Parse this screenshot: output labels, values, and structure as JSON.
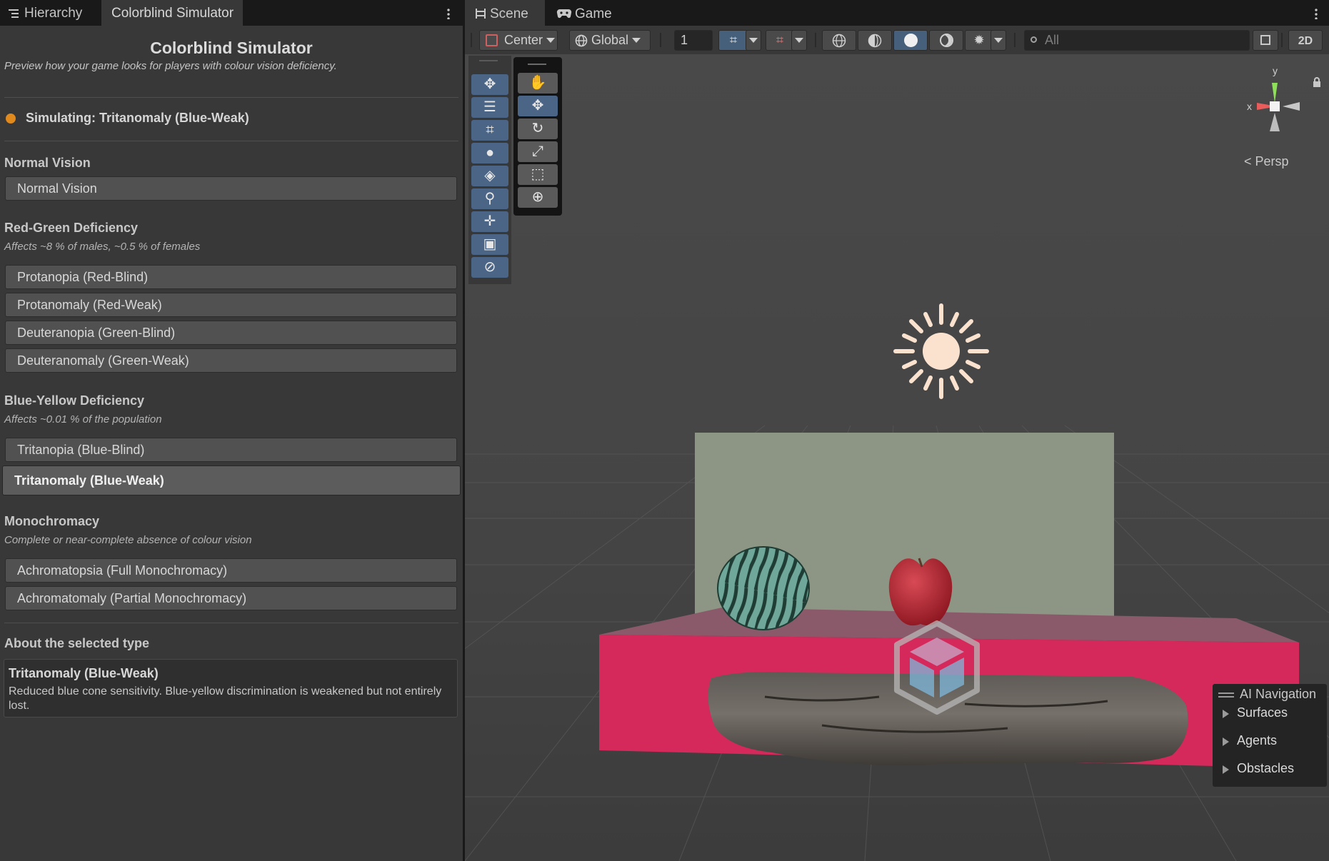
{
  "left_tabs": {
    "hierarchy": "Hierarchy",
    "simulator": "Colorblind Simulator"
  },
  "panel": {
    "title": "Colorblind Simulator",
    "subtitle": "Preview how your game looks for players with colour vision deficiency.",
    "status": "Simulating: Tritanomaly  (Blue-Weak)",
    "status_color": "#e08a1e"
  },
  "sections": {
    "normal": {
      "heading": "Normal Vision",
      "options": [
        "Normal Vision"
      ]
    },
    "red_green": {
      "heading": "Red-Green Deficiency",
      "note": "Affects ~8 % of males, ~0.5 % of females",
      "options": [
        "Protanopia  (Red-Blind)",
        "Protanomaly  (Red-Weak)",
        "Deuteranopia  (Green-Blind)",
        "Deuteranomaly  (Green-Weak)"
      ]
    },
    "blue_yellow": {
      "heading": "Blue-Yellow Deficiency",
      "note": "Affects ~0.01 % of the population",
      "options": [
        "Tritanopia  (Blue-Blind)",
        "Tritanomaly  (Blue-Weak)"
      ]
    },
    "mono": {
      "heading": "Monochromacy",
      "note": "Complete or near-complete absence of colour vision",
      "options": [
        "Achromatopsia  (Full Monochromacy)",
        "Achromatomaly  (Partial Monochromacy)"
      ]
    }
  },
  "selected": "Tritanomaly  (Blue-Weak)",
  "about": {
    "heading": "About the selected type",
    "title": "Tritanomaly  (Blue-Weak)",
    "description": "Reduced blue cone sensitivity. Blue-yellow discrimination is weakened but not entirely lost."
  },
  "right_tabs": {
    "scene": "Scene",
    "game": "Game"
  },
  "toolbar": {
    "pivot": "Center",
    "space": "Global",
    "grid_size": "1",
    "search_placeholder": "All"
  },
  "gizmo": {
    "y": "y",
    "x": "x",
    "projection": "Persp"
  },
  "nav_overlay": {
    "title": "AI Navigation",
    "items": [
      "Surfaces",
      "Agents",
      "Obstacles"
    ]
  },
  "colors": {
    "accent": "#46607c",
    "selected_bg": "#5c5c5c"
  }
}
